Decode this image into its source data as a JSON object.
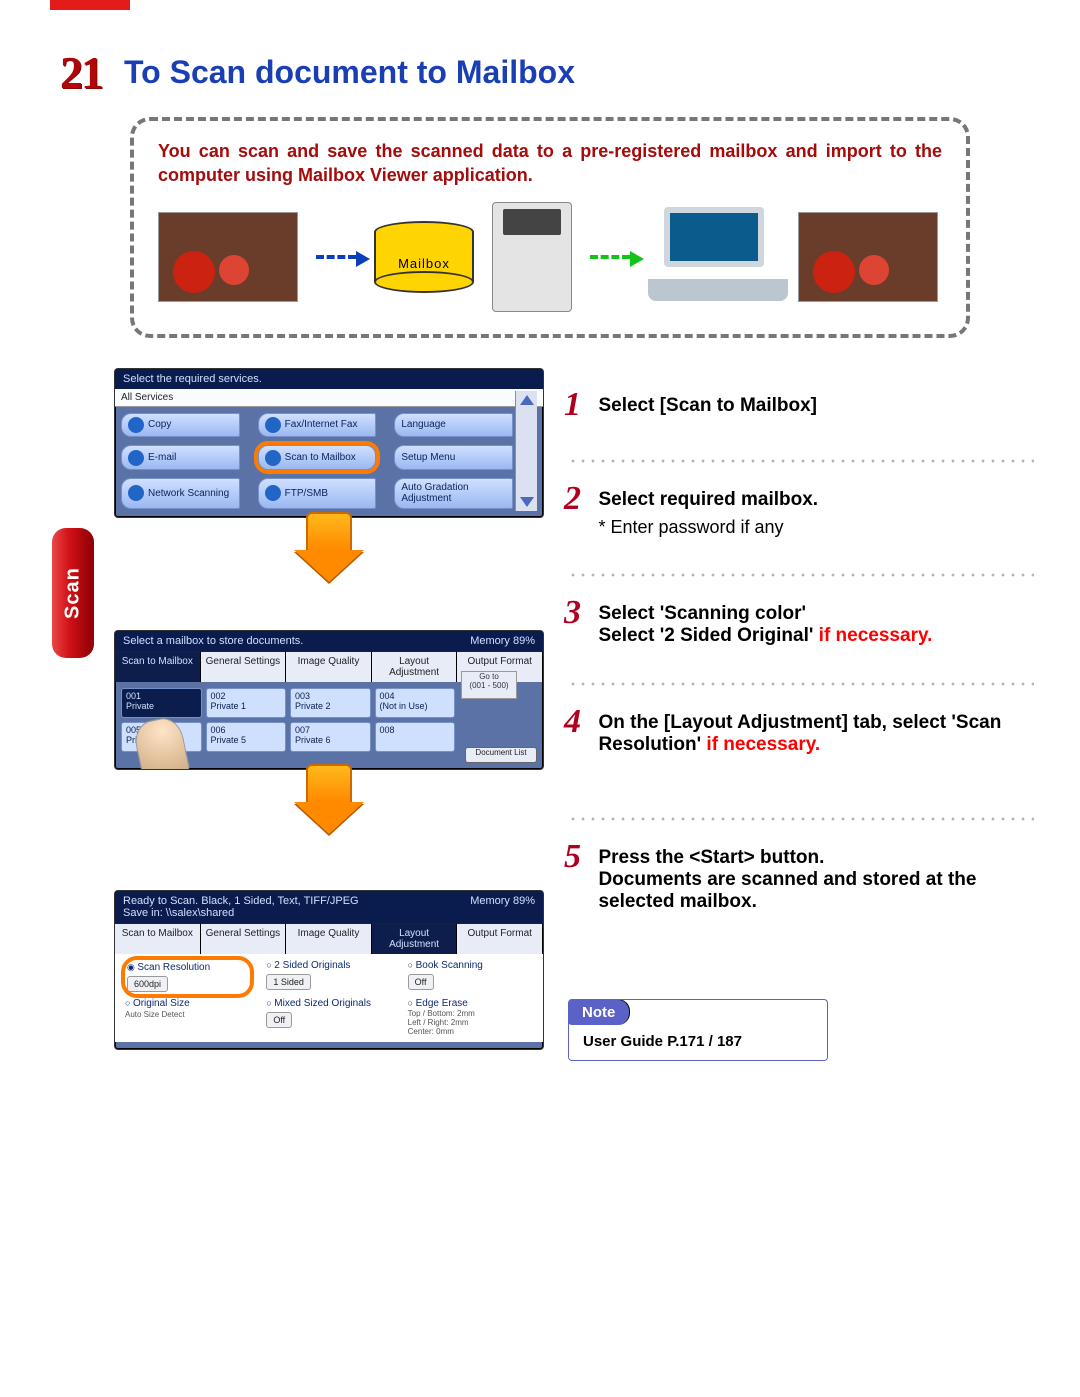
{
  "section_number": "21",
  "section_title": "To Scan document to Mailbox",
  "side_tab": "Scan",
  "intro_text": "You can scan and save the scanned data to a pre-registered mailbox and import to the computer using Mailbox Viewer application.",
  "mailbox_cylinder_label": "Mailbox",
  "panel1": {
    "title": "Select the required services.",
    "all_services": "All Services",
    "services": {
      "copy": "Copy",
      "email": "E-mail",
      "netscan": "Network Scanning",
      "fax": "Fax/Internet Fax",
      "scan_mailbox": "Scan to Mailbox",
      "ftp": "FTP/SMB",
      "language": "Language",
      "setup": "Setup Menu",
      "autograd": "Auto Gradation Adjustment"
    }
  },
  "panel2": {
    "title": "Select a mailbox to store documents.",
    "memory": "Memory 89%",
    "tabs": {
      "t0": "Scan to Mailbox",
      "t1": "General Settings",
      "t2": "Image Quality",
      "t3": "Layout Adjustment",
      "t4": "Output Format"
    },
    "goto_label": "Go to",
    "goto_range": "(001 - 500)",
    "slots": {
      "s001": {
        "num": "001",
        "name": "Private"
      },
      "s002": {
        "num": "002",
        "name": "Private 1"
      },
      "s003": {
        "num": "003",
        "name": "Private 2"
      },
      "s004": {
        "num": "004",
        "name": "(Not in Use)"
      },
      "s005": {
        "num": "005",
        "name": "Private 4"
      },
      "s006": {
        "num": "006",
        "name": "Private 5"
      },
      "s007": {
        "num": "007",
        "name": "Private 6"
      },
      "s008": {
        "num": "008",
        "name": ""
      }
    },
    "doclist": "Document List"
  },
  "panel3": {
    "status_top": "Ready to Scan.\nBlack, 1 Sided, Text, TIFF/JPEG",
    "status_save": "Save in: \\\\salex\\shared",
    "memory": "Memory 89%",
    "tabs": {
      "t0": "Scan to Mailbox",
      "t1": "General Settings",
      "t2": "Image Quality",
      "t3": "Layout Adjustment",
      "t4": "Output Format"
    },
    "resolution_hdr": "Scan Resolution",
    "resolution_val": "600dpi",
    "twosided_hdr": "2 Sided Originals",
    "twosided_val": "1 Sided",
    "book_hdr": "Book Scanning",
    "book_val": "Off",
    "orig_hdr": "Original Size",
    "orig_val": "Auto Size Detect",
    "mixed_hdr": "Mixed Sized Originals",
    "mixed_val": "Off",
    "edge_hdr": "Edge Erase",
    "edge_val1": "Top / Bottom: 2mm",
    "edge_val2": "Left / Right: 2mm",
    "edge_val3": "Center: 0mm"
  },
  "steps": {
    "s1": {
      "num": "1",
      "text": "Select [Scan to Mailbox]"
    },
    "s2": {
      "num": "2",
      "text": "Select required mailbox.",
      "sub": "* Enter password if any"
    },
    "s3": {
      "num": "3",
      "line1": "Select 'Scanning color'",
      "line2a": "Select '2 Sided Original' ",
      "line2b": "if necessary."
    },
    "s4": {
      "num": "4",
      "line1": "On the [Layout Adjustment] tab, select 'Scan Resolution' ",
      "line2": "if necessary."
    },
    "s5": {
      "num": "5",
      "line1": "Press the <Start> button.",
      "line2": "Documents are scanned and stored at the selected mailbox."
    }
  },
  "note": {
    "label": "Note",
    "text": "User Guide P.171 / 187"
  }
}
